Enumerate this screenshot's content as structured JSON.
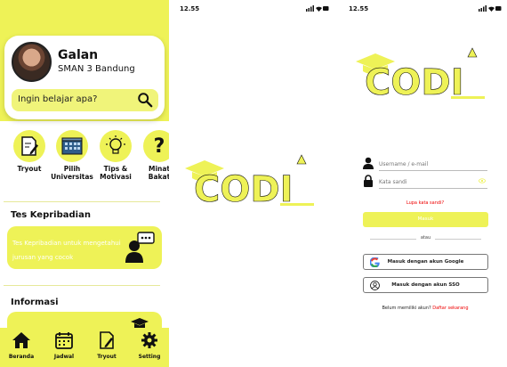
{
  "home": {
    "user_name": "Galan",
    "user_school": "SMAN 3 Bandung",
    "search_placeholder": "Ingin belajar apa?",
    "menu": [
      {
        "label": "Tryout",
        "icon": "document-edit-icon"
      },
      {
        "label": "Pilih Universitas",
        "icon": "university-building-icon"
      },
      {
        "label": "Tips & Motivasi",
        "icon": "lightbulb-icon"
      },
      {
        "label": "Minat Bakat",
        "icon": "question-mark-icon"
      }
    ],
    "section_personality_title": "Tes Kepribadian",
    "personality_promo_text": "Tes Kepribadian untuk mengetahui jurusan yang cocok",
    "section_info_title": "Informasi",
    "bottom_nav": [
      {
        "label": "Beranda",
        "icon": "home-icon"
      },
      {
        "label": "Jadwal",
        "icon": "calendar-icon"
      },
      {
        "label": "Tryout",
        "icon": "document-edit-icon"
      },
      {
        "label": "Setting",
        "icon": "gear-icon"
      }
    ]
  },
  "splash": {
    "status_time": "12.55",
    "logo_text": "CODI"
  },
  "login": {
    "status_time": "12.55",
    "logo_text": "CODI",
    "username_placeholder": "Username / e-mail",
    "password_placeholder": "Kata sandi",
    "forgot_password": "Lupa kata sandi?",
    "login_button": "Masuk",
    "or_text": "atau",
    "google_button": "Masuk dengan akun Google",
    "sso_button": "Masuk dengan akun SSO",
    "register_prompt": "Belum memiliki akun?",
    "register_link": "Daftar sekarang"
  },
  "colors": {
    "accent": "#eef257",
    "link_red": "#e00000",
    "text": "#111111"
  }
}
